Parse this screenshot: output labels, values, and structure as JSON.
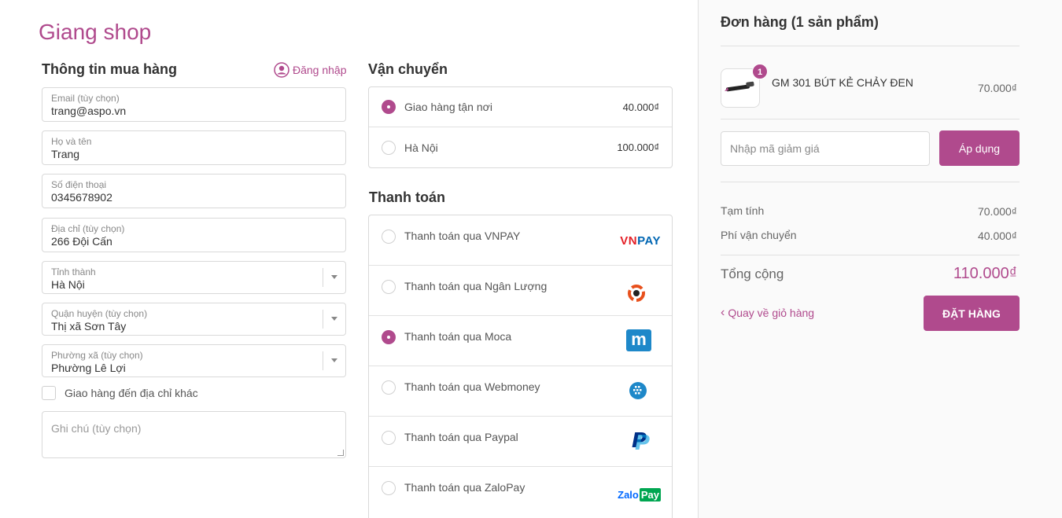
{
  "shop": {
    "title": "Giang shop"
  },
  "buyer": {
    "title": "Thông tin mua hàng",
    "login_label": "Đăng nhập",
    "fields": [
      {
        "label": "Email (tùy chọn)",
        "value": "trang@aspo.vn"
      },
      {
        "label": "Họ và tên",
        "value": "Trang"
      },
      {
        "label": "Số điện thoại",
        "value": "0345678902"
      },
      {
        "label": "Địa chỉ (tùy chọn)",
        "value": "266 Đội Cấn"
      }
    ],
    "selects": [
      {
        "label": "Tỉnh thành",
        "value": "Hà Nội"
      },
      {
        "label": "Quận huyện (tùy chọn)",
        "value": "Thị xã Sơn Tây"
      },
      {
        "label": "Phường xã (tùy chọn)",
        "value": "Phường Lê Lợi"
      }
    ],
    "other_address_label": "Giao hàng đến địa chỉ khác",
    "note_placeholder": "Ghi chú (tùy chọn)"
  },
  "shipping": {
    "title": "Vận chuyển",
    "options": [
      {
        "label": "Giao hàng tận nơi",
        "price": "40.000₫",
        "selected": true
      },
      {
        "label": "Hà Nội",
        "price": "100.000₫",
        "selected": false
      }
    ]
  },
  "payment": {
    "title": "Thanh toán",
    "methods": [
      {
        "label": "Thanh toán qua VNPAY",
        "logo": "vnpay-logo",
        "logo_text": "VNPAY",
        "selected": false
      },
      {
        "label": "Thanh toán qua Ngân Lượng",
        "logo": "nganluong-logo",
        "selected": false
      },
      {
        "label": "Thanh toán qua Moca",
        "logo": "moca-logo",
        "logo_text": "m",
        "selected": true
      },
      {
        "label": "Thanh toán qua Webmoney",
        "logo": "webmoney-logo",
        "selected": false
      },
      {
        "label": "Thanh toán qua Paypal",
        "logo": "paypal-logo",
        "logo_text": "P",
        "selected": false
      },
      {
        "label": "Thanh toán qua ZaloPay",
        "logo": "zalopay-logo",
        "logo_text_1": "Zalo",
        "logo_text_2": "Pay",
        "selected": false
      }
    ]
  },
  "order": {
    "title": "Đơn hàng (1 sản phẩm)",
    "item": {
      "name": "GM 301 BÚT KẺ CHẢY ĐEN",
      "price": "70.000₫",
      "qty": "1"
    },
    "discount_placeholder": "Nhập mã giảm giá",
    "apply_label": "Áp dụng",
    "subtotal_label": "Tạm tính",
    "subtotal_value": "70.000₫",
    "shipping_label": "Phí vận chuyển",
    "shipping_value": "40.000₫",
    "total_label": "Tổng cộng",
    "total_value": "110.000₫",
    "back_label": "Quay về giỏ hàng",
    "order_label": "ĐẶT HÀNG"
  },
  "colors": {
    "accent": "#b04a8d",
    "vnpay_red": "#e41f26",
    "vnpay_blue": "#0066b3",
    "moca_blue": "#1e88c9",
    "paypal_blue": "#003087",
    "zalo_blue": "#0068ff",
    "zalo_green": "#00a651"
  }
}
